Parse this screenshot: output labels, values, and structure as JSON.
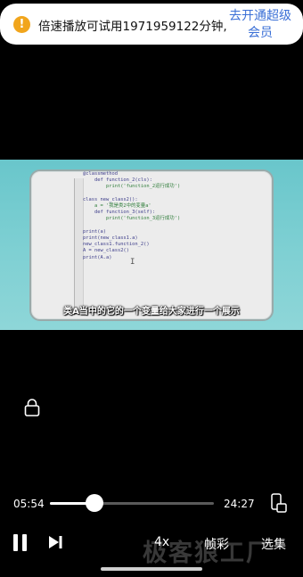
{
  "banner": {
    "icon": "warning-icon",
    "message": "倍速播放可试用1971959122分钟,",
    "vip_link": "去开通超级会员",
    "vip_color": "#3a6fd6"
  },
  "video": {
    "code_lines": [
      "@classmethod",
      "    def function_2(cls):",
      "        print('function_2运行成功')",
      "",
      "class new_class2():",
      "    a = '我是类2中的变量a'",
      "    def function_3(self):",
      "        print('function_3运行成功')",
      "",
      "print(a)",
      "print(new_class1.a)",
      "new_class1.function_2()",
      "A = new_class2()",
      "print(A.a)"
    ],
    "subtitle": "类A当中的它的一个变量给大家进行一个展示"
  },
  "player": {
    "current_time": "05:54",
    "duration": "24:27",
    "progress": 0.27,
    "speed": "4x",
    "quality": "帧彩",
    "episodes": "选集",
    "watermark": "极客狼工厂"
  }
}
